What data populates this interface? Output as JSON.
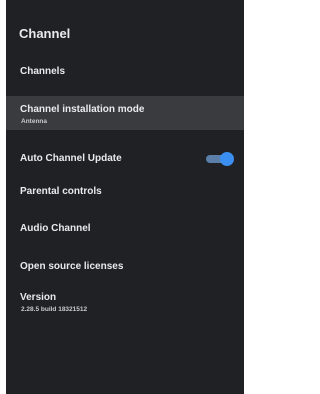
{
  "panel": {
    "title": "Channel"
  },
  "menu": {
    "channels": {
      "label": "Channels"
    },
    "installation_mode": {
      "label": "Channel installation mode",
      "value": "Antenna"
    },
    "auto_update": {
      "label": "Auto Channel Update",
      "toggle_on": true
    },
    "parental": {
      "label": "Parental controls"
    },
    "audio": {
      "label": "Audio Channel"
    },
    "licenses": {
      "label": "Open source licenses"
    },
    "version": {
      "label": "Version",
      "value": "2.28.5 build 18321512"
    }
  },
  "colors": {
    "panel_bg": "#202124",
    "selected_bg": "#3a3b3e",
    "toggle_accent": "#3b8ff0"
  }
}
